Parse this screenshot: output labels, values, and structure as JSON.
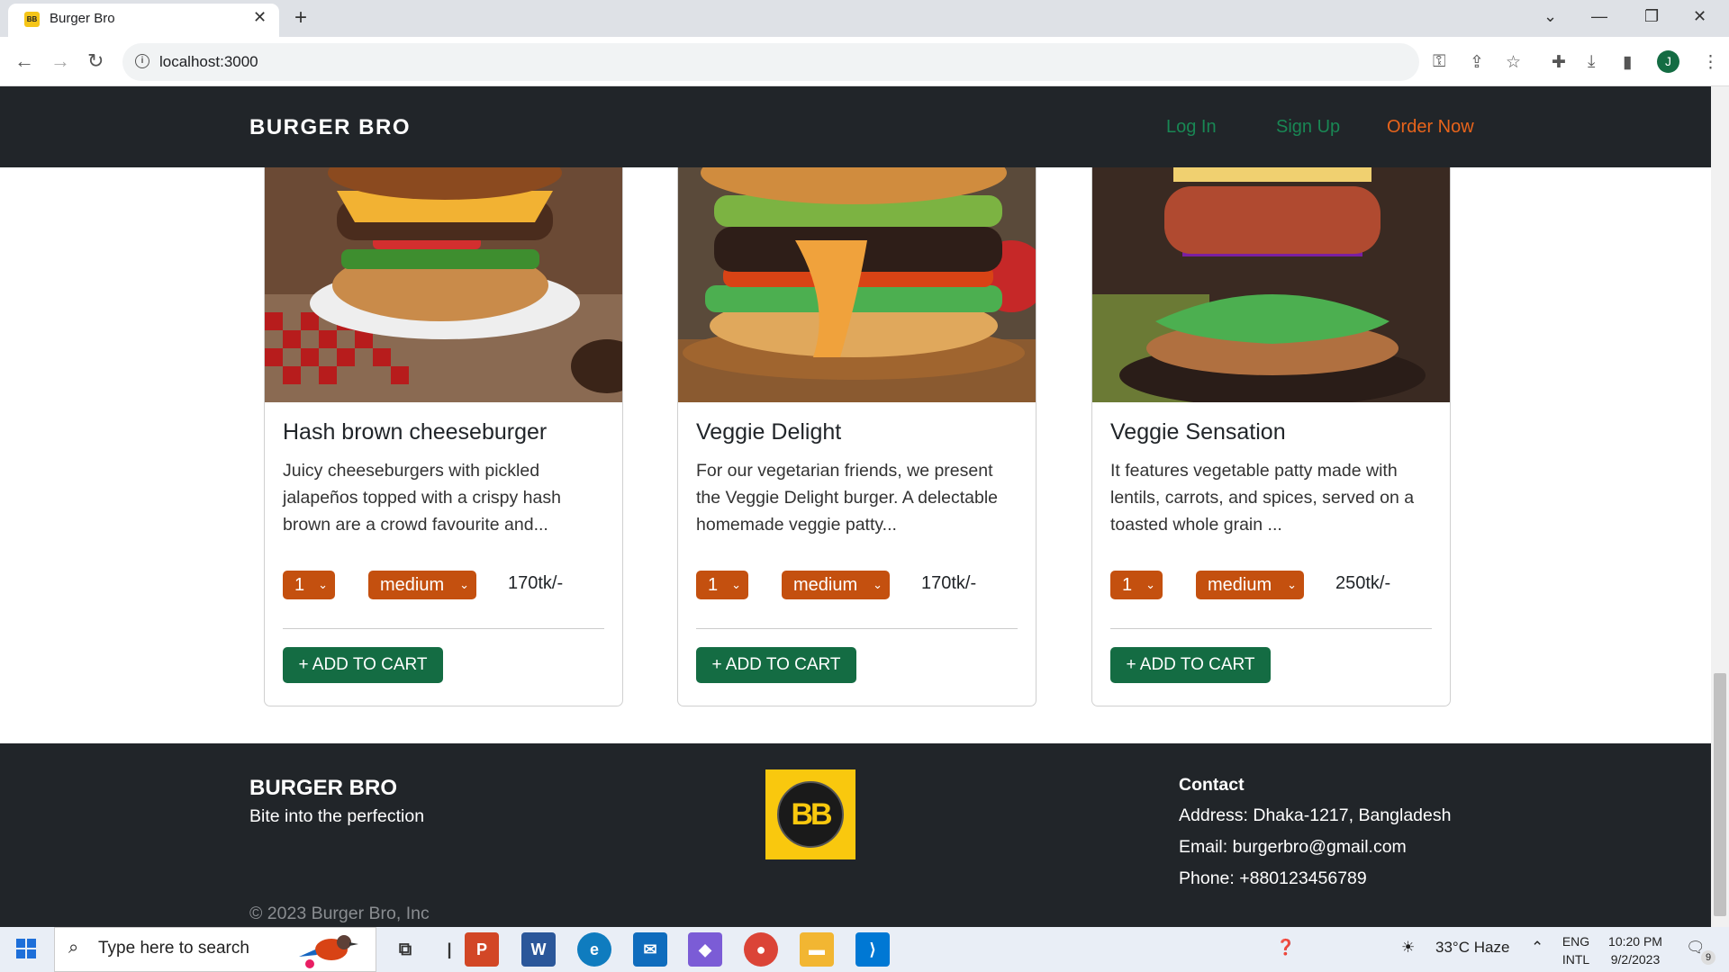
{
  "browser": {
    "tab_title": "Burger Bro",
    "favicon_text": "BB",
    "url": "localhost:3000",
    "avatar_letter": "J"
  },
  "nav": {
    "brand": "BURGER BRO",
    "login": "Log In",
    "signup": "Sign Up",
    "order": "Order Now"
  },
  "products": [
    {
      "title": "Hash brown cheeseburger",
      "desc": "Juicy cheeseburgers with pickled jalapeños topped with a crispy hash brown are a crowd favourite and...",
      "qty": "1",
      "size": "medium",
      "price": "170tk/-",
      "add_label": "+ ADD TO CART"
    },
    {
      "title": "Veggie Delight",
      "desc": "For our vegetarian friends, we present the Veggie Delight burger. A delectable homemade veggie patty...",
      "qty": "1",
      "size": "medium",
      "price": "170tk/-",
      "add_label": "+ ADD TO CART"
    },
    {
      "title": "Veggie Sensation",
      "desc": "It features vegetable patty made with lentils, carrots, and spices, served on a toasted whole grain ...",
      "qty": "1",
      "size": "medium",
      "price": "250tk/-",
      "add_label": "+ ADD TO CART"
    }
  ],
  "footer": {
    "brand": "BURGER BRO",
    "tagline": "Bite into the perfection",
    "logo_text": "BB",
    "contact_heading": "Contact",
    "address": "Address: Dhaka-1217, Bangladesh",
    "email": "Email: burgerbro@gmail.com",
    "phone": "Phone: +880123456789",
    "copyright": "© 2023 Burger Bro, Inc"
  },
  "taskbar": {
    "search_placeholder": "Type here to search",
    "weather": "33°C  Haze",
    "lang_1": "ENG",
    "lang_2": "INTL",
    "time": "10:20 PM",
    "date": "9/2/2023",
    "notif_count": "9"
  },
  "colors": {
    "accent_green": "#146c43",
    "accent_orange": "#c4500f",
    "dark_bg": "#212529"
  }
}
